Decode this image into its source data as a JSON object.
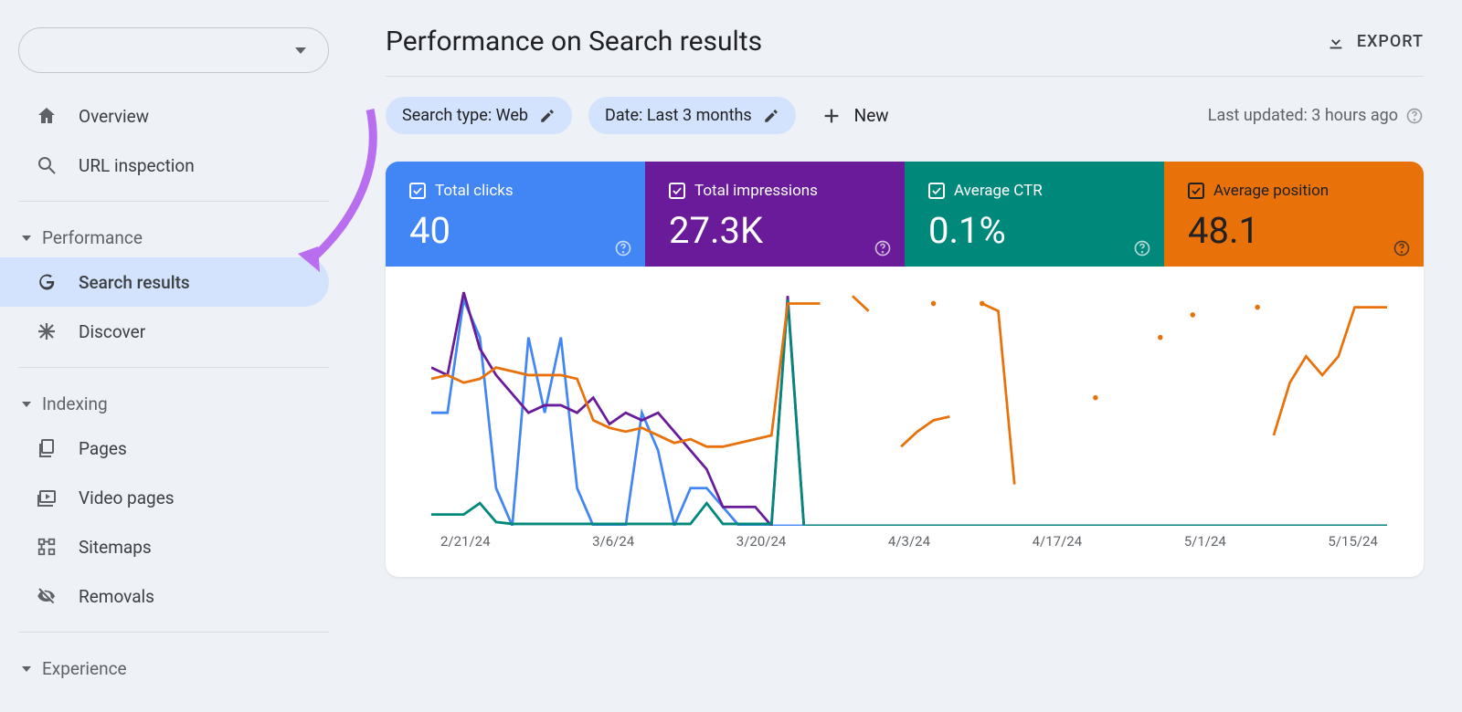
{
  "sidebar": {
    "overview": "Overview",
    "url_inspection": "URL inspection",
    "sections": {
      "performance": "Performance",
      "indexing": "Indexing",
      "experience": "Experience"
    },
    "items": {
      "search_results": "Search results",
      "discover": "Discover",
      "pages": "Pages",
      "video_pages": "Video pages",
      "sitemaps": "Sitemaps",
      "removals": "Removals"
    }
  },
  "header": {
    "title": "Performance on Search results",
    "export": "EXPORT"
  },
  "filters": {
    "search_type": "Search type: Web",
    "date": "Date: Last 3 months",
    "new": "New",
    "last_updated": "Last updated: 3 hours ago"
  },
  "metrics": [
    {
      "label": "Total clicks",
      "value": "40",
      "color": "#4285f4"
    },
    {
      "label": "Total impressions",
      "value": "27.3K",
      "color": "#6a1b9a"
    },
    {
      "label": "Average CTR",
      "value": "0.1%",
      "color": "#00897b"
    },
    {
      "label": "Average position",
      "value": "48.1",
      "color": "#e8710a"
    }
  ],
  "chart_data": {
    "type": "line",
    "x_labels": [
      "2/21/24",
      "3/6/24",
      "3/20/24",
      "4/3/24",
      "4/17/24",
      "5/1/24",
      "5/15/24"
    ],
    "series": [
      {
        "name": "Total clicks",
        "color": "#4285f4",
        "values": [
          3,
          3,
          6,
          5,
          1,
          0,
          5,
          3,
          5,
          1,
          0,
          0,
          0,
          3,
          2,
          0,
          1,
          1,
          0.5,
          0,
          0,
          0,
          0,
          0,
          0,
          0,
          0,
          0,
          0,
          0,
          0,
          0,
          0,
          0,
          0,
          0,
          0,
          0,
          0,
          0,
          0,
          0,
          0,
          0,
          0,
          0,
          0,
          0,
          0,
          0,
          0,
          0,
          0,
          0,
          0,
          0,
          0,
          0,
          0,
          0
        ]
      },
      {
        "name": "Total impressions",
        "color": "#6a1b9a",
        "values": [
          4.2,
          4,
          6.2,
          4.7,
          4,
          3.5,
          3,
          3.2,
          3.2,
          3,
          3.4,
          2.7,
          3,
          2.8,
          3,
          2.5,
          2,
          1.5,
          0.5,
          0.5,
          0.5,
          0,
          6.1,
          0,
          0,
          0,
          0,
          0,
          0,
          0,
          0,
          0,
          0,
          0,
          0,
          0,
          0,
          0,
          0,
          0,
          0,
          0,
          0,
          0,
          0,
          0,
          0,
          0,
          0,
          0,
          0,
          0,
          0,
          0,
          0,
          0,
          0,
          0,
          0,
          0
        ]
      },
      {
        "name": "Average CTR",
        "color": "#00897b",
        "values": [
          0.3,
          0.3,
          0.3,
          0.6,
          0.1,
          0.05,
          0.05,
          0.05,
          0.05,
          0.05,
          0.05,
          0.05,
          0.05,
          0.05,
          0.05,
          0.05,
          0.05,
          0.6,
          0.05,
          0.05,
          0.05,
          0.05,
          6.0,
          0,
          0,
          0,
          0,
          0,
          0,
          0,
          0,
          0,
          0,
          0,
          0,
          0,
          0,
          0,
          0,
          0,
          0,
          0,
          0,
          0,
          0,
          0,
          0,
          0,
          0,
          0,
          0,
          0,
          0,
          0,
          0,
          0,
          0,
          0,
          0,
          0
        ]
      },
      {
        "name": "Average position",
        "color": "#e8710a",
        "segments": [
          {
            "start": 0,
            "values": [
              3.9,
              4.0,
              3.8,
              3.9,
              4.2,
              4.1,
              4.0,
              4.0,
              4.0,
              3.9,
              2.8,
              2.6,
              2.5,
              2.6,
              2.4,
              2.2,
              2.3,
              2.1,
              2.1,
              2.2,
              2.3,
              2.4,
              5.9,
              5.9,
              5.9
            ]
          },
          {
            "start": 26,
            "values": [
              6.1,
              5.7
            ]
          },
          {
            "start": 29,
            "values": [
              2.1,
              2.5,
              2.8,
              2.9
            ]
          },
          {
            "start": 34,
            "values": [
              5.9,
              5.7,
              1.1
            ]
          },
          {
            "start": 52,
            "values": [
              2.4,
              3.8,
              4.5,
              4.0,
              4.5,
              5.8,
              5.8,
              5.8
            ]
          }
        ],
        "points": [
          {
            "x": 31,
            "y": 5.9
          },
          {
            "x": 34,
            "y": 5.9
          },
          {
            "x": 41,
            "y": 3.4
          },
          {
            "x": 45,
            "y": 5.0
          },
          {
            "x": 47,
            "y": 5.6
          },
          {
            "x": 51,
            "y": 5.8
          }
        ]
      }
    ],
    "y_range": [
      0,
      6.3
    ]
  }
}
